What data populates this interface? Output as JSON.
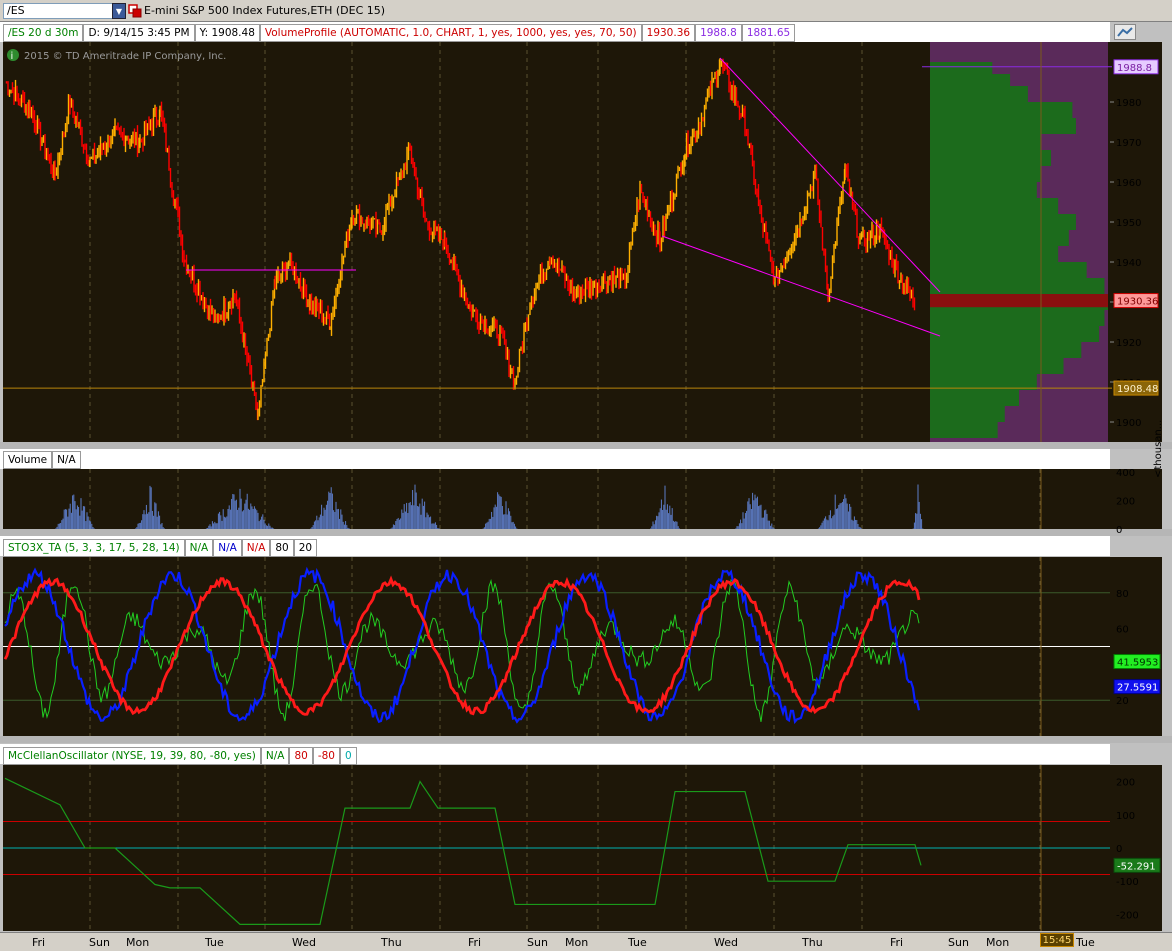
{
  "toolbar": {
    "symbol": "/ES",
    "instrument_title": "E-mini S&P 500 Index Futures,ETH (DEC 15)"
  },
  "price_pane": {
    "legend": [
      "/ES 20 d 30m",
      "D: 9/14/15 3:45 PM",
      "Y: 1908.48",
      "VolumeProfile (AUTOMATIC, 1.0, CHART, 1, yes, 1000, yes, yes, 70, 50)",
      "1930.36",
      "1988.8",
      "1881.65"
    ],
    "legend_colors": [
      "#008000",
      "#000000",
      "#000000",
      "#cc0000",
      "#cc0000",
      "#8a2be2",
      "#8a2be2"
    ],
    "copyright": "2015 © TD Ameritrade IP Company, Inc.",
    "badges": {
      "vp_high": "1988.8",
      "last_price": "1930.36",
      "crosshair": "1908.48"
    }
  },
  "volume_pane": {
    "legend": [
      "Volume",
      "N/A"
    ],
    "unit_label": "<thousan..."
  },
  "stoch_pane": {
    "legend": [
      "STO3X_TA (5, 3, 3, 17, 5, 28, 14)",
      "N/A",
      "N/A",
      "N/A",
      "80",
      "20"
    ],
    "legend_colors": [
      "#008000",
      "#008000",
      "#0000cc",
      "#cc0000",
      "#000000",
      "#000000"
    ],
    "badges": {
      "green": "41.5953",
      "blue": "27.5591"
    }
  },
  "mcclellan_pane": {
    "legend": [
      "McClellanOscillator (NYSE, 19, 39, 80, -80, yes)",
      "N/A",
      "80",
      "-80",
      "0"
    ],
    "legend_colors": [
      "#008000",
      "#008000",
      "#cc0000",
      "#cc0000",
      "#00aaaa"
    ],
    "badges": {
      "value": "-52.291"
    }
  },
  "time_axis": {
    "labels": [
      "Fri",
      "Sun",
      "Mon",
      "Tue",
      "Wed",
      "Thu",
      "Fri",
      "Sun",
      "Mon",
      "Tue",
      "Wed",
      "Thu",
      "Fri",
      "Sun",
      "Mon",
      "Tue"
    ],
    "crosshair_time": "15:45"
  },
  "colors": {
    "background": "#1e1708",
    "up": "#ffb000",
    "down": "#ff0000",
    "profile_green": "#1c6b1c",
    "profile_purple": "#5a2a5a",
    "trendline": "#ff00ff"
  },
  "chart_data": [
    {
      "type": "line",
      "title": "/ES 20 d 30m",
      "ylim": [
        1895,
        1995
      ],
      "y_ticks": [
        1900,
        1910,
        1920,
        1930,
        1940,
        1950,
        1960,
        1970,
        1980
      ],
      "x": [
        "Fri",
        "Mon",
        "Tue",
        "Tue",
        "Wed",
        "Wed",
        "Thu",
        "Thu",
        "Fri",
        "Fri",
        "Mon",
        "Tue",
        "Tue",
        "Wed",
        "Wed",
        "Thu",
        "Thu",
        "Thu",
        "Fri",
        "Fri"
      ],
      "series": [
        {
          "values": [
            1985,
            1965,
            1972,
            1940,
            1918,
            1901,
            1938,
            1925,
            1953,
            1970,
            1943,
            1925,
            1910,
            1942,
            1933,
            1948,
            1962,
            1988,
            1952,
            1935,
            1958,
            1936,
            1963,
            1940,
            1948,
            1937,
            1930
          ]
        }
      ],
      "levels": [
        {
          "name": "1988.8",
          "value": 1988.8
        },
        {
          "name": "1930.36",
          "value": 1930.36
        },
        {
          "name": "1908.48",
          "value": 1908.48
        }
      ]
    },
    {
      "type": "bar",
      "title": "Volume",
      "ylim": [
        0,
        420
      ],
      "y_ticks": [
        0,
        200,
        400
      ]
    },
    {
      "type": "line",
      "title": "STO3X_TA (5, 3, 3, 17, 5, 28, 14)",
      "ylim": [
        0,
        100
      ],
      "y_ticks": [
        20,
        40,
        60,
        80
      ],
      "last_values": {
        "green": 41.5953,
        "blue": 27.5591
      }
    },
    {
      "type": "line",
      "title": "McClellanOscillator (NYSE, 19, 39, 80, -80, yes)",
      "ylim": [
        -250,
        250
      ],
      "y_ticks": [
        -200,
        -100,
        0,
        100,
        200
      ],
      "levels": [
        80,
        -80,
        0
      ],
      "series": [
        {
          "name": "McClellanOscillator",
          "values": [
            210,
            130,
            0,
            0,
            -110,
            -120,
            -120,
            -230,
            -230,
            -230,
            120,
            120,
            200,
            120,
            120,
            120,
            -170,
            -170,
            -170,
            -170,
            170,
            170,
            170,
            -100,
            -100,
            -100,
            10,
            10,
            10,
            -52.291
          ]
        }
      ]
    }
  ]
}
